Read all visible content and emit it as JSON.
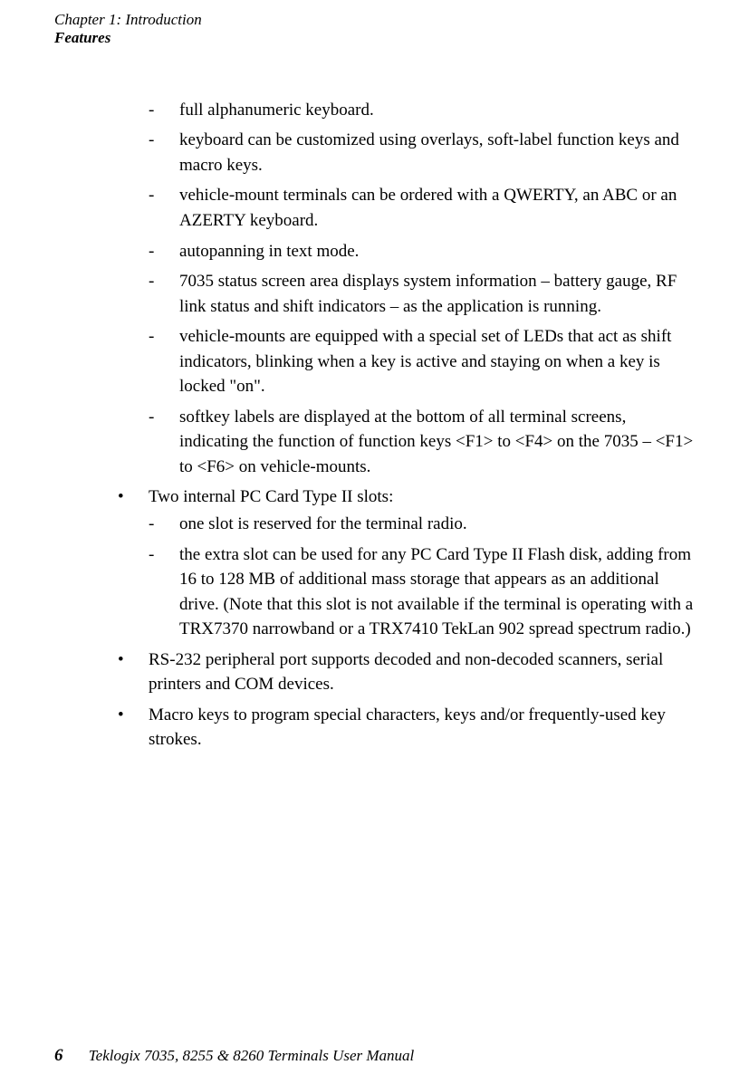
{
  "header": {
    "chapter": "Chapter 1: Introduction",
    "section": "Features"
  },
  "top_dashes": [
    "full alphanumeric keyboard.",
    "keyboard can be customized using overlays, soft-label function keys and macro keys.",
    "vehicle-mount terminals can be ordered with a QWERTY, an ABC or an AZERTY keyboard.",
    "autopanning in text mode.",
    "7035 status screen area displays system information – battery gauge, RF link status and shift indicators – as the application is running.",
    "vehicle-mounts are equipped with a special set of LEDs that act as shift indicators, blinking when a key is active and staying on when a key is locked \"on\".",
    "softkey labels are displayed at the bottom of all terminal screens, indicating the function of function keys <F1> to <F4> on the 7035 – <F1> to <F6> on vehicle-mounts."
  ],
  "bullets": [
    {
      "text": "Two internal PC Card Type II slots:",
      "dashes": [
        "one slot is reserved for the terminal radio.",
        "the extra slot can be used for any PC Card Type II Flash disk, adding from 16 to 128 MB of additional mass storage that appears as an additional drive. (Note that this slot is not available if the terminal is operating with a TRX7370 narrowband or a TRX7410 TekLan 902 spread spectrum radio.)"
      ]
    },
    {
      "text": "RS-232 peripheral port supports decoded and non-decoded scanners, serial printers and COM devices.",
      "dashes": []
    },
    {
      "text": "Macro keys to program special characters, keys and/or frequently-used key strokes.",
      "dashes": []
    }
  ],
  "footer": {
    "page": "6",
    "title": "Teklogix 7035, 8255 & 8260 Terminals User Manual"
  }
}
